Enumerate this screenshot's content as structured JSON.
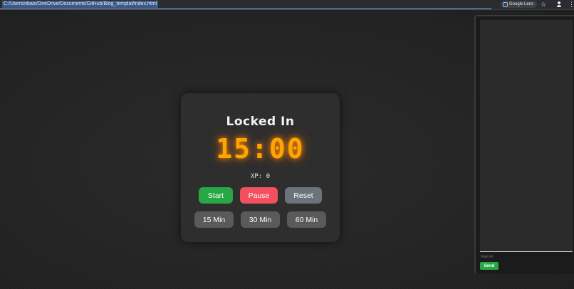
{
  "browser": {
    "url": "C:/Users/nbais/OneDrive/Documents/GitHub/Blog_templat/index.html",
    "lens_label": "Google Lens",
    "star_icon": "star-icon",
    "profile_icon": "profile-icon",
    "menu_icon": "kebab-menu-icon"
  },
  "timer": {
    "title": "Locked In",
    "time": "15:00",
    "xp": "XP: 0",
    "time_color": "#ffa500"
  },
  "controls": {
    "start": "Start",
    "pause": "Pause",
    "reset": "Reset",
    "start_color": "#28a745",
    "pause_color": "#f24f5f",
    "reset_color": "#6c737a"
  },
  "presets": [
    "15 Min",
    "30 Min",
    "60 Min"
  ],
  "chat": {
    "placeholder": "Ask AI",
    "send_label": "Send"
  }
}
